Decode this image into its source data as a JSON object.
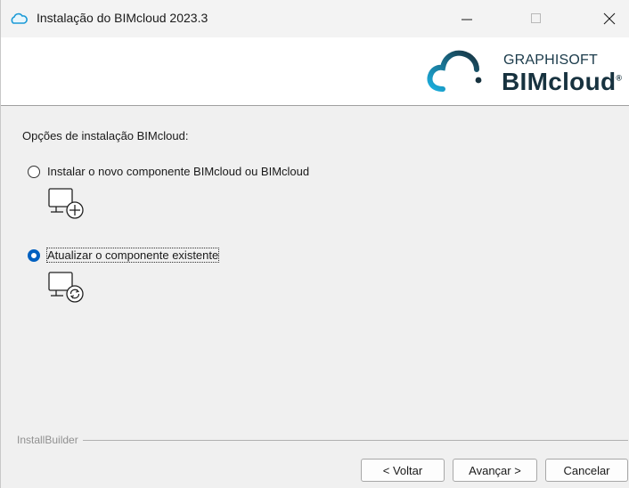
{
  "window": {
    "title": "Instalação do BIMcloud 2023.3"
  },
  "banner": {
    "brand_small": "GRAPHISOFT",
    "brand_big": "BIMcloud",
    "brand_reg": "®"
  },
  "content": {
    "title": "Opções de instalação BIMcloud:",
    "options": [
      {
        "label": "Instalar o novo componente BIMcloud ou BIMcloud",
        "selected": false,
        "icon": "monitor-plus-icon"
      },
      {
        "label": "Atualizar o componente existente",
        "selected": true,
        "icon": "monitor-refresh-icon"
      }
    ]
  },
  "footer": {
    "builder_label": "InstallBuilder",
    "back_label": "< Voltar",
    "next_label": "Avançar >",
    "cancel_label": "Cancelar"
  },
  "colors": {
    "accent": "#0060c0",
    "cloud_gradient_start": "#1bb0e0",
    "brand_text": "#17323f"
  }
}
